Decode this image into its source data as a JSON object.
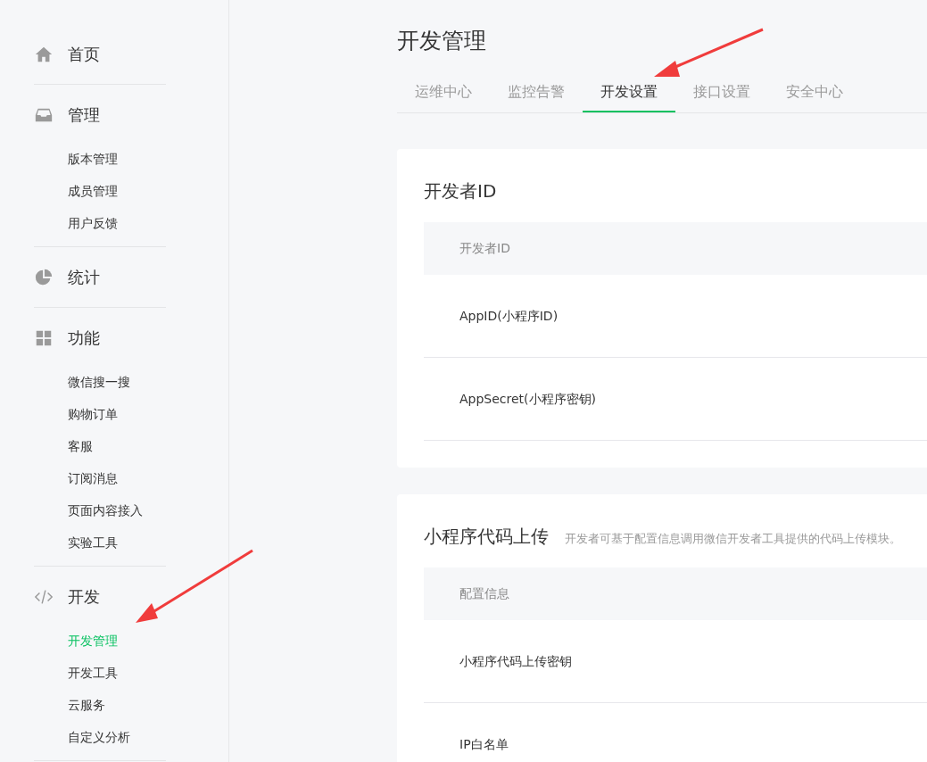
{
  "sidebar": {
    "groups": [
      {
        "label": "首页",
        "kind": "home"
      },
      {
        "label": "管理",
        "kind": "inbox",
        "items": [
          {
            "label": "版本管理",
            "selected": false
          },
          {
            "label": "成员管理",
            "selected": false
          },
          {
            "label": "用户反馈",
            "selected": false
          }
        ]
      },
      {
        "label": "统计",
        "kind": "pie"
      },
      {
        "label": "功能",
        "kind": "grid",
        "items": [
          {
            "label": "微信搜一搜",
            "selected": false
          },
          {
            "label": "购物订单",
            "selected": false
          },
          {
            "label": "客服",
            "selected": false
          },
          {
            "label": "订阅消息",
            "selected": false
          },
          {
            "label": "页面内容接入",
            "selected": false
          },
          {
            "label": "实验工具",
            "selected": false
          }
        ]
      },
      {
        "label": "开发",
        "kind": "code",
        "items": [
          {
            "label": "开发管理",
            "selected": true
          },
          {
            "label": "开发工具",
            "selected": false
          },
          {
            "label": "云服务",
            "selected": false
          },
          {
            "label": "自定义分析",
            "selected": false
          }
        ]
      }
    ]
  },
  "page": {
    "title": "开发管理",
    "tabs": [
      {
        "label": "运维中心",
        "selected": false
      },
      {
        "label": "监控告警",
        "selected": false
      },
      {
        "label": "开发设置",
        "selected": true
      },
      {
        "label": "接口设置",
        "selected": false
      },
      {
        "label": "安全中心",
        "selected": false
      }
    ],
    "cards": [
      {
        "title": "开发者ID",
        "table_header": "开发者ID",
        "rows": [
          "AppID(小程序ID)",
          "AppSecret(小程序密钥)"
        ]
      },
      {
        "title": "小程序代码上传",
        "description": "开发者可基于配置信息调用微信开发者工具提供的代码上传模块。",
        "table_header": "配置信息",
        "rows": [
          "小程序代码上传密钥",
          "IP白名单"
        ]
      }
    ]
  }
}
